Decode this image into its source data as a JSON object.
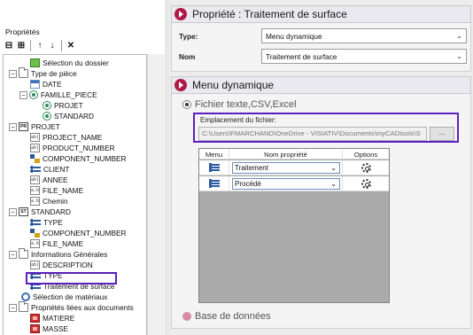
{
  "left": {
    "title": "Propriétés",
    "toolbar": [
      {
        "name": "collapse-all-icon",
        "glyph": "⊟"
      },
      {
        "name": "expand-all-icon",
        "glyph": "⊞"
      },
      {
        "name": "move-up-icon",
        "glyph": "↑"
      },
      {
        "name": "move-down-icon",
        "glyph": "↓"
      },
      {
        "name": "delete-icon",
        "glyph": "✕"
      }
    ],
    "tree": {
      "selection_dossier": "Sélection du dossier",
      "type_piece": "Type de pièce",
      "date": "DATE",
      "famille_piece": "FAMILLE_PIECE",
      "projet_radio": "PROJET",
      "standard_radio": "STANDARD",
      "projet": "PROJET",
      "project_name": "PROJECT_NAME",
      "product_number": "PRODUCT_NUMBER",
      "component_number": "COMPONENT_NUMBER",
      "client": "CLIENT",
      "annee": "ANNEE",
      "file_name": "FILE_NAME",
      "chemin": "Chemin",
      "standard": "STANDARD",
      "type": "TYPE",
      "component_number_2": "COMPONENT_NUMBER",
      "file_name_2": "FILE_NAME",
      "infos_generales": "Informations Générales",
      "description": "DESCRIPTION",
      "type_2": "TYPE",
      "traitement_surface": "Traitement de surface",
      "selection_materiaux": "Sélection de matériaux",
      "proprietes_documents": "Propriétés liées aux documents",
      "matiere": "MATIERE",
      "masse": "MASSE"
    }
  },
  "right": {
    "header1": "Propriété : Traitement de surface",
    "type_label": "Type:",
    "type_value": "Menu dynamique",
    "nom_label": "Nom",
    "nom_value": "Traitement de surface",
    "header2": "Menu dynamique",
    "radio_file": "Fichier texte,CSV,Excel",
    "file_label": "Emplacement du fichier:",
    "file_path": "C:\\Users\\FMARCHAND\\OneDrive - VISIATIV\\Documents\\myCADtools\\S",
    "browse_label": "...",
    "grid": {
      "headers": {
        "menu": "Menu",
        "prop": "Nom propriété",
        "options": "Options"
      },
      "rows": [
        {
          "prop": "Traitement"
        },
        {
          "prop": "Procédé"
        }
      ]
    },
    "radio_db": "Base de données"
  },
  "colors": {
    "accent": "#5b1fbf",
    "header_icon": "#b01845"
  }
}
